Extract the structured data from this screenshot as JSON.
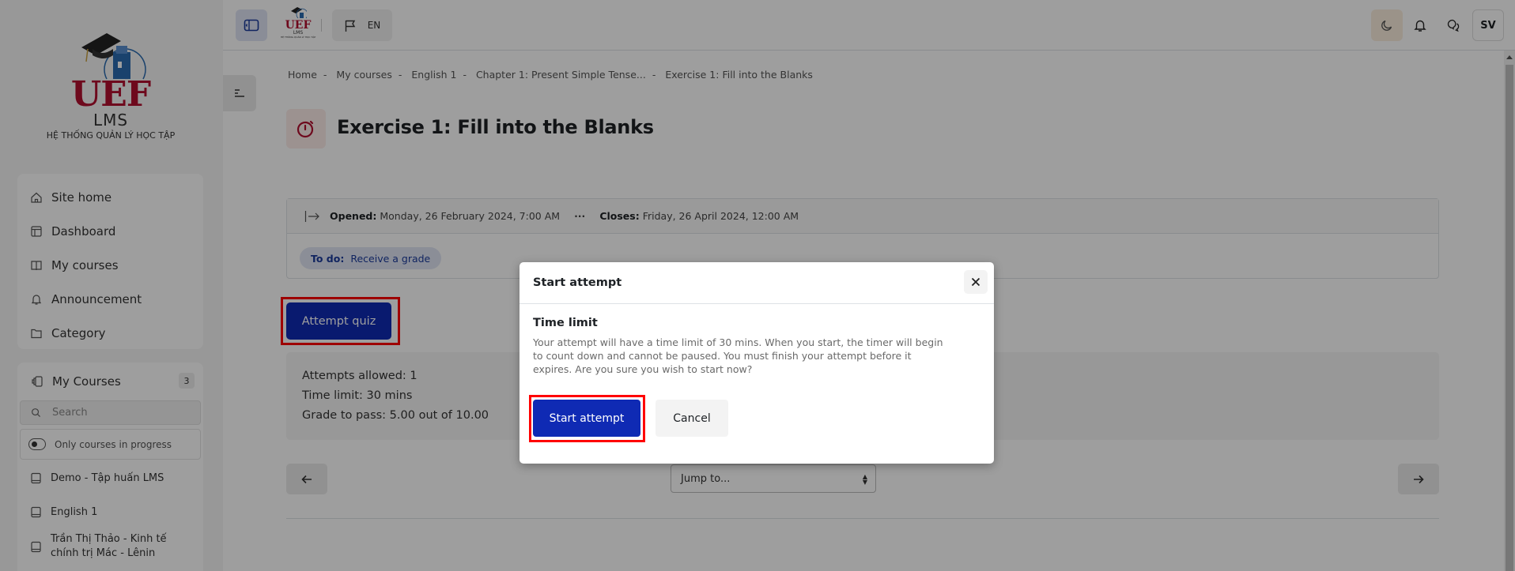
{
  "brand": {
    "logo_text": "UEF",
    "product": "LMS",
    "tagline": "HỆ THỐNG QUẢN LÝ HỌC TẬP"
  },
  "topbar": {
    "language": "EN",
    "avatar_initials": "SV",
    "icons": [
      "sidebar-toggle-icon",
      "flag-icon",
      "moon-icon",
      "bell-icon",
      "chat-icon"
    ]
  },
  "sidebar": {
    "nav": [
      {
        "label": "Site home",
        "icon": "home-icon"
      },
      {
        "label": "Dashboard",
        "icon": "dashboard-icon"
      },
      {
        "label": "My courses",
        "icon": "book-open-icon"
      },
      {
        "label": "Announcement",
        "icon": "bell-icon"
      },
      {
        "label": "Category",
        "icon": "folder-icon"
      }
    ],
    "my_courses": {
      "title": "My Courses",
      "count": "3",
      "search_placeholder": "Search",
      "filter_label": "Only courses in progress",
      "courses": [
        "Demo - Tập huấn LMS",
        "English 1",
        "Trần Thị Thảo - Kinh tế chính trị Mác - Lênin"
      ]
    }
  },
  "breadcrumb": [
    "Home",
    "My courses",
    "English 1",
    "Chapter 1: Present Simple Tense...",
    "Exercise 1: Fill into the Blanks"
  ],
  "page": {
    "title": "Exercise 1: Fill into the Blanks",
    "opened_label": "Opened:",
    "opened_value": "Monday, 26 February 2024, 7:00 AM",
    "closes_label": "Closes:",
    "closes_value": "Friday, 26 April 2024, 12:00 AM",
    "todo_label": "To do:",
    "todo_value": "Receive a grade",
    "attempt_button": "Attempt quiz",
    "info": [
      "Attempts allowed: 1",
      "Time limit: 30 mins",
      "Grade to pass: 5.00 out of 10.00"
    ],
    "jump_placeholder": "Jump to..."
  },
  "modal": {
    "title": "Start attempt",
    "section_title": "Time limit",
    "message": "Your attempt will have a time limit of 30 mins. When you start, the timer will begin to count down and cannot be paused. You must finish your attempt before it expires. Are you sure you wish to start now?",
    "start_button": "Start attempt",
    "cancel_button": "Cancel"
  },
  "colors": {
    "primary": "#0f2ab4",
    "brand_red": "#b2102f",
    "highlight": "#ff0000"
  }
}
